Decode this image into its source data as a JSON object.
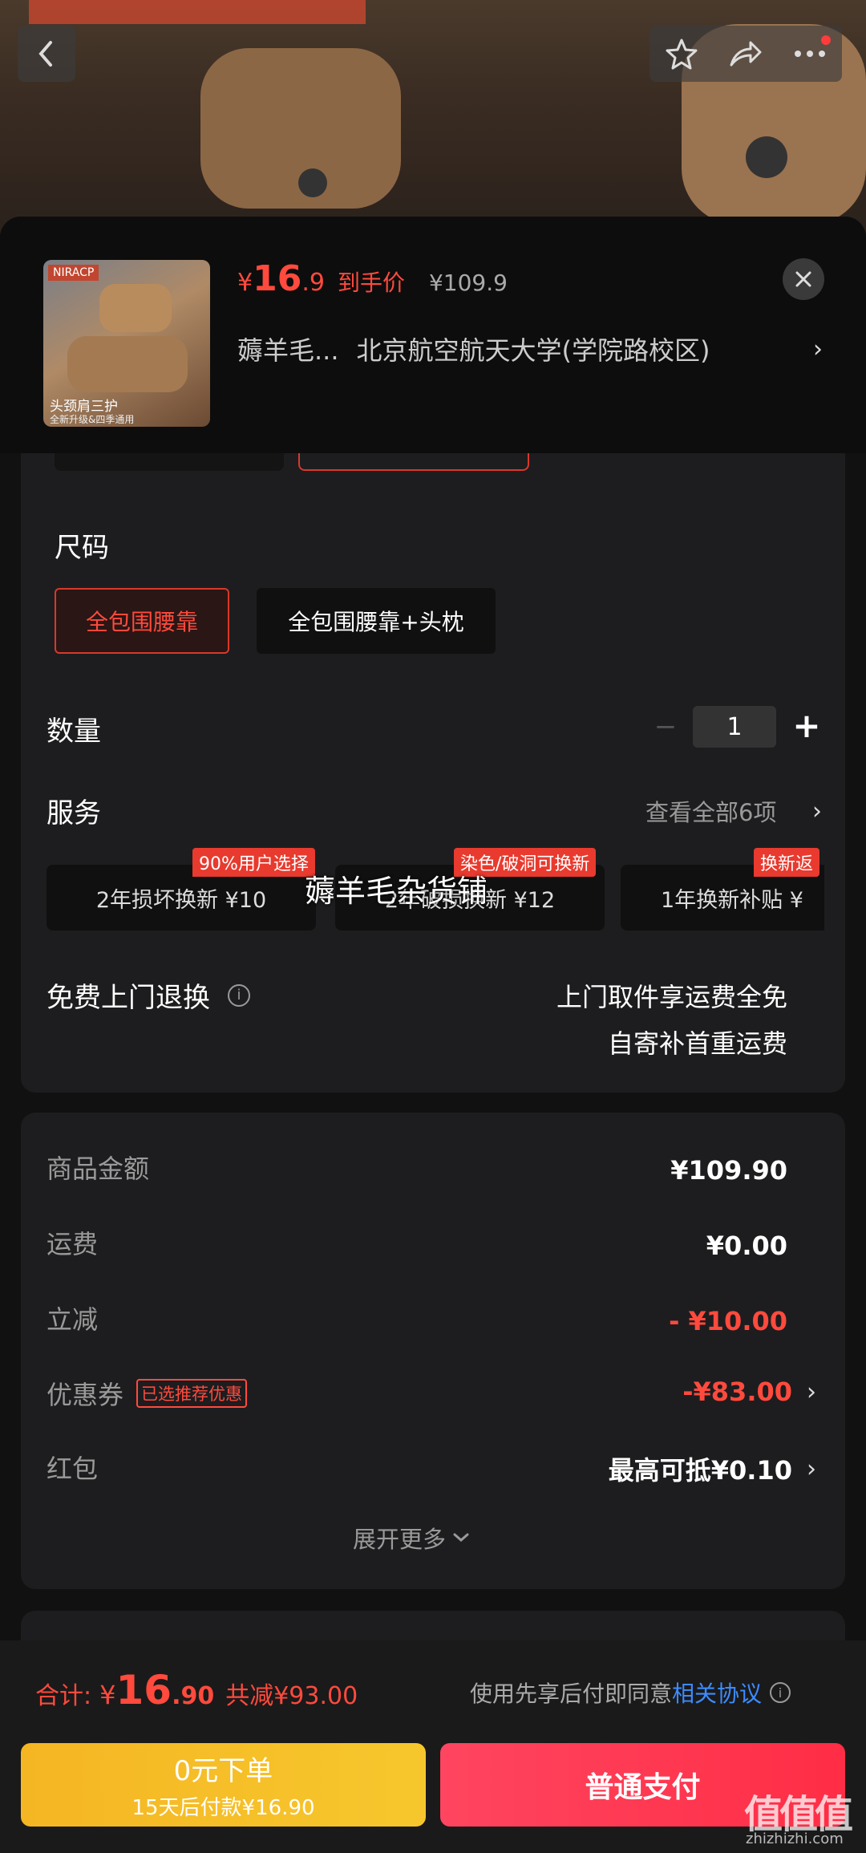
{
  "product_image": {
    "brand_tag": "NIRACP",
    "caption": "头颈肩三护",
    "sub_caption": "全新升级&四季通用"
  },
  "header": {
    "price_symbol": "¥",
    "price_int": "16",
    "price_dec": ".9",
    "price_label": "到手价",
    "original_price": "¥109.9",
    "shop_short": "薅羊毛...",
    "address": "北京航空航天大学(学院路校区)"
  },
  "size": {
    "title": "尺码",
    "options": [
      "全包围腰靠",
      "全包围腰靠+头枕"
    ],
    "selected": 0
  },
  "quantity": {
    "title": "数量",
    "value": "1",
    "minus": "−",
    "plus": "+"
  },
  "services": {
    "title": "服务",
    "view_all": "查看全部6项",
    "items": [
      {
        "label": "2年损坏换新  ¥10",
        "tag": "90%用户选择"
      },
      {
        "label": "2年破损换新  ¥12",
        "tag": "染色/破洞可换新"
      },
      {
        "label": "1年换新补贴  ¥",
        "tag": "换新返"
      }
    ],
    "watermark": "薅羊毛杂货铺"
  },
  "return_service": {
    "title": "免费上门退换",
    "line1": "上门取件享运费全免",
    "line2": "自寄补首重运费"
  },
  "summary": {
    "rows": [
      {
        "label": "商品金额",
        "value": "¥109.90"
      },
      {
        "label": "运费",
        "value": "¥0.00"
      },
      {
        "label": "立减",
        "value": "- ¥10.00"
      },
      {
        "label": "优惠券",
        "badge": "已选推荐优惠",
        "value": "-¥83.00"
      },
      {
        "label": "红包",
        "value": "最高可抵¥0.10"
      }
    ],
    "expand": "展开更多"
  },
  "footer": {
    "total_label": "合计:",
    "total_symbol": "¥",
    "total_int": "16",
    "total_dec": ".90",
    "saved": "共减¥93.00",
    "agreement_prefix": "使用先享后付即同意",
    "agreement_link": "相关协议",
    "pay_later_title": "0元下单",
    "pay_later_sub": "15天后付款¥16.90",
    "pay_now": "普通支付"
  },
  "watermark": {
    "logo": "值值值",
    "site": "zhizhizhi.com"
  },
  "colors": {
    "accent_red": "#ff4a3d",
    "link_blue": "#3d8bff",
    "pay_later_yellow": "#f5b623",
    "pay_now_red": "#ff2d45"
  }
}
